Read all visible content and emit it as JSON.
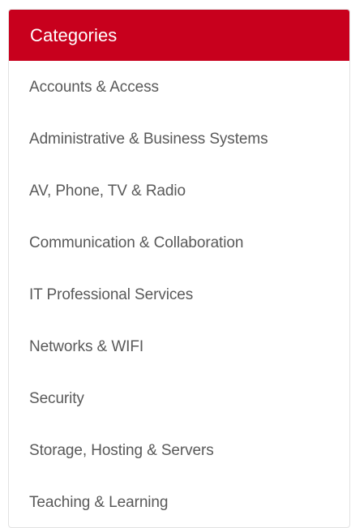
{
  "categories_panel": {
    "title": "Categories",
    "colors": {
      "header_bg": "#c8001d",
      "header_text": "#ffffff",
      "link_text": "#595959"
    },
    "items": [
      {
        "label": "Accounts & Access"
      },
      {
        "label": "Administrative & Business Systems"
      },
      {
        "label": "AV, Phone, TV & Radio"
      },
      {
        "label": "Communication & Collaboration"
      },
      {
        "label": "IT Professional Services"
      },
      {
        "label": "Networks & WIFI"
      },
      {
        "label": "Security"
      },
      {
        "label": "Storage, Hosting & Servers"
      },
      {
        "label": "Teaching & Learning"
      }
    ]
  }
}
